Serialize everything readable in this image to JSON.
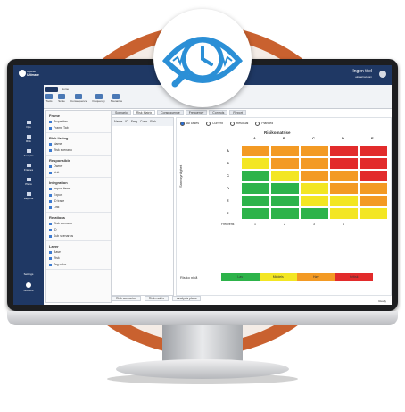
{
  "app": {
    "sidebar_logo_line1": "MyRisk",
    "sidebar_logo_line2": "Ultimate",
    "header_title": "Ingen titel",
    "header_sub": "eksternal.com",
    "sidebar_items": [
      "Ops",
      "Risk",
      "Analysis",
      "Frames",
      "Plans",
      "Reports"
    ],
    "sidebar_bottom": [
      "Settings",
      "Account"
    ]
  },
  "ribbon": {
    "groups": [
      "Tools",
      "Scale",
      "Consequence",
      "Frequency",
      "Scenarios"
    ],
    "file_tab": "File",
    "home_tab": "Home"
  },
  "left_panel": {
    "sections": [
      {
        "title": "Frame",
        "items": [
          "Properties",
          "Frame Tab"
        ]
      },
      {
        "title": "Risk listing",
        "items": [
          "Name",
          "Risk scenario"
        ]
      },
      {
        "title": "Responsible",
        "items": [
          "Owner",
          "Unit"
        ]
      },
      {
        "title": "Integration",
        "items": [
          "Import items",
          "Export",
          "ID trace",
          "Link"
        ]
      },
      {
        "title": "Relations",
        "items": [
          "Risk scenario",
          "ID",
          "Sub scenarios"
        ]
      },
      {
        "title": "Layer",
        "items": [
          "Base",
          "Risk",
          "Tag color"
        ]
      }
    ]
  },
  "tabs": [
    "Scenario",
    "Risk Matrix",
    "Consequence",
    "Frequency",
    "Controls",
    "Report"
  ],
  "table_header": [
    "Name",
    "ID",
    "Freq",
    "Cons",
    "Risk"
  ],
  "matrix": {
    "title": "Risikomatrise",
    "options": [
      "All cases",
      "Current",
      "Residual",
      "Planned"
    ],
    "col_letters": [
      "A",
      "B",
      "C",
      "D",
      "E"
    ],
    "row_letters": [
      "A",
      "B",
      "C",
      "D",
      "E",
      "F"
    ],
    "ylabel": "Sannsynlighet",
    "footer_row_label": "Frekvens",
    "footer_values": [
      "1",
      "2",
      "3",
      "4"
    ],
    "legend_label": "Risiko nivå",
    "legend": [
      "Lav",
      "Middels",
      "Høy",
      "Kritisk"
    ],
    "colors": {
      "green": "#2db34a",
      "yellow": "#f3e623",
      "orange": "#f39a24",
      "red": "#e22b2b"
    }
  },
  "bottom_tabs": [
    "Risk scenarios",
    "Risk matrix",
    "Analysis plans"
  ],
  "status": "Ready"
}
